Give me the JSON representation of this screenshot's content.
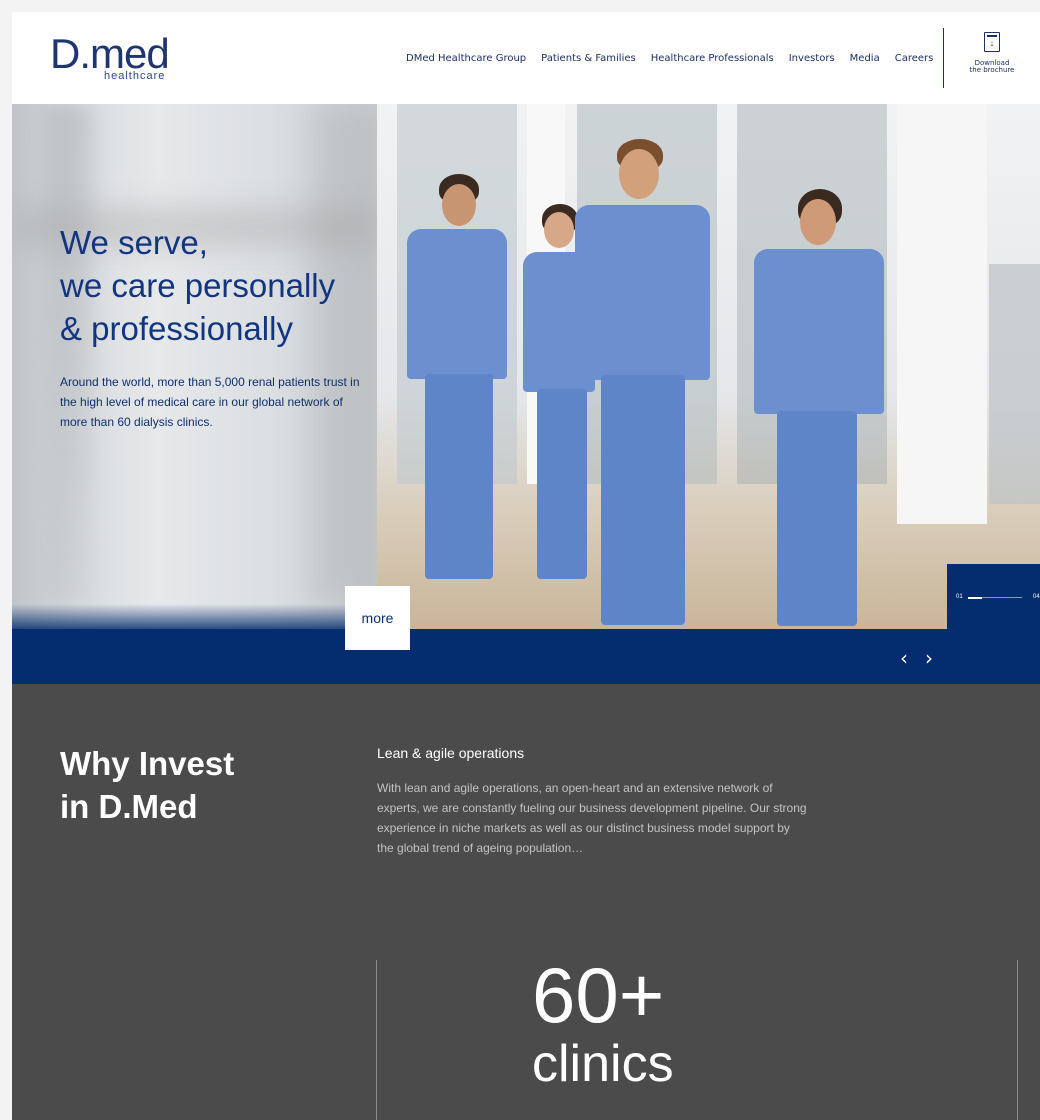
{
  "logo": {
    "main": "D.med",
    "sub": "healthcare"
  },
  "nav": {
    "items": [
      "DMed Healthcare Group",
      "Patients & Families",
      "Healthcare Professionals",
      "Investors",
      "Media",
      "Careers"
    ],
    "brochure_label_1": "Download",
    "brochure_label_2": "the brochure",
    "brochure_icon": "download-icon"
  },
  "hero": {
    "title_lines": [
      "We serve,",
      "we care personally",
      "& professionally"
    ],
    "text": "Around the world, more than 5,000 renal patients trust in the high level of medical care in our global network of more than 60 dialysis clinics.",
    "more_label": "more",
    "slide_current": "01",
    "slide_total": "04",
    "prev_arrow": "‹",
    "next_arrow": "›",
    "colors": {
      "accent": "#032d6e",
      "title": "#123580"
    }
  },
  "invest": {
    "title_lines": [
      "Why Invest",
      "in D.Med"
    ],
    "heading": "Lean & agile operations",
    "text": "With lean and agile operations, an open-heart and an extensive network of experts, we are constantly fueling our business development pipeline. Our strong experience in niche markets as well as our distinct business model support by the global trend of ageing population…",
    "stat": {
      "value": "60+",
      "label": "clinics"
    }
  }
}
